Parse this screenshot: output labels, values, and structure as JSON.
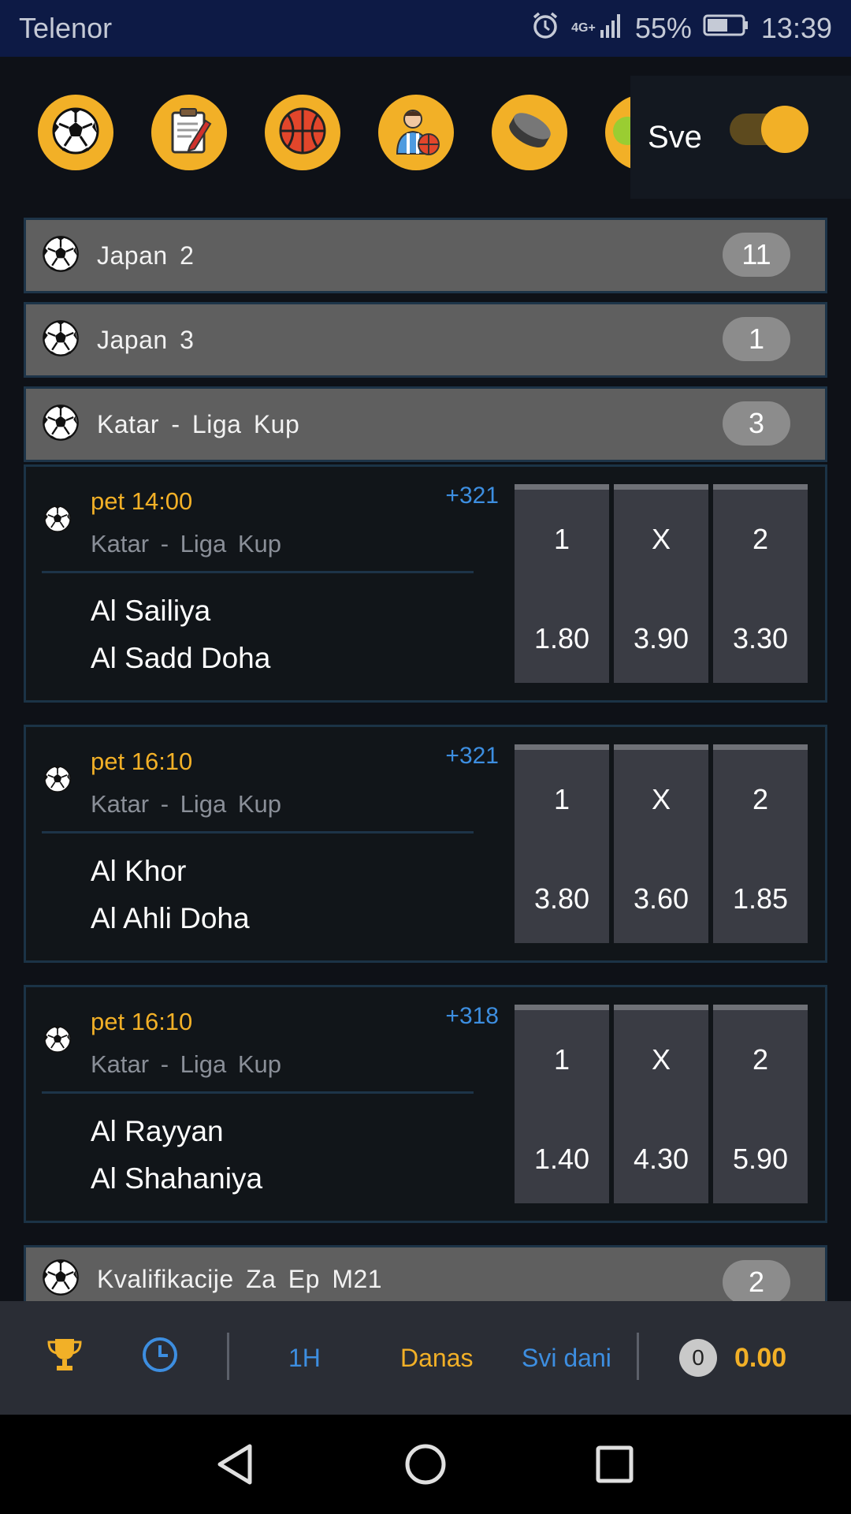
{
  "status_bar": {
    "carrier": "Telenor",
    "network": "4G+",
    "battery": "55%",
    "time": "13:39"
  },
  "sports": {
    "items": [
      {
        "name": "soccer-icon"
      },
      {
        "name": "ticket-icon"
      },
      {
        "name": "basketball-icon"
      },
      {
        "name": "player-icon"
      },
      {
        "name": "hockey-puck-icon"
      },
      {
        "name": "tennis-icon"
      }
    ],
    "toggle_label": "Sve",
    "toggle_on": true
  },
  "leagues": [
    {
      "name": "Japan 2",
      "count": "11"
    },
    {
      "name": "Japan 3",
      "count": "1"
    },
    {
      "name": "Katar - Liga Kup",
      "count": "3"
    }
  ],
  "matches": [
    {
      "time": "pet 14:00",
      "league": "Katar - Liga Kup",
      "more": "+321",
      "home": "Al Sailiya",
      "away": "Al Sadd Doha",
      "odds": [
        {
          "label": "1",
          "value": "1.80"
        },
        {
          "label": "X",
          "value": "3.90"
        },
        {
          "label": "2",
          "value": "3.30"
        }
      ]
    },
    {
      "time": "pet 16:10",
      "league": "Katar - Liga Kup",
      "more": "+321",
      "home": "Al Khor",
      "away": "Al Ahli Doha",
      "odds": [
        {
          "label": "1",
          "value": "3.80"
        },
        {
          "label": "X",
          "value": "3.60"
        },
        {
          "label": "2",
          "value": "1.85"
        }
      ]
    },
    {
      "time": "pet 16:10",
      "league": "Katar - Liga Kup",
      "more": "+318",
      "home": "Al Rayyan",
      "away": "Al Shahaniya",
      "odds": [
        {
          "label": "1",
          "value": "1.40"
        },
        {
          "label": "X",
          "value": "4.30"
        },
        {
          "label": "2",
          "value": "5.90"
        }
      ]
    }
  ],
  "next_league": {
    "name": "Kvalifikacije Za Ep M21",
    "count": "2"
  },
  "bottom_bar": {
    "filter_1h": "1H",
    "filter_today": "Danas",
    "filter_all": "Svi dani",
    "ticket_count": "0",
    "balance": "0.00"
  },
  "colors": {
    "accent": "#f2b027",
    "link_blue": "#3d8ee0",
    "status_bar_bg": "#0d1a45",
    "league_bg": "#5f5f5f",
    "odd_bg": "#3a3c44"
  }
}
